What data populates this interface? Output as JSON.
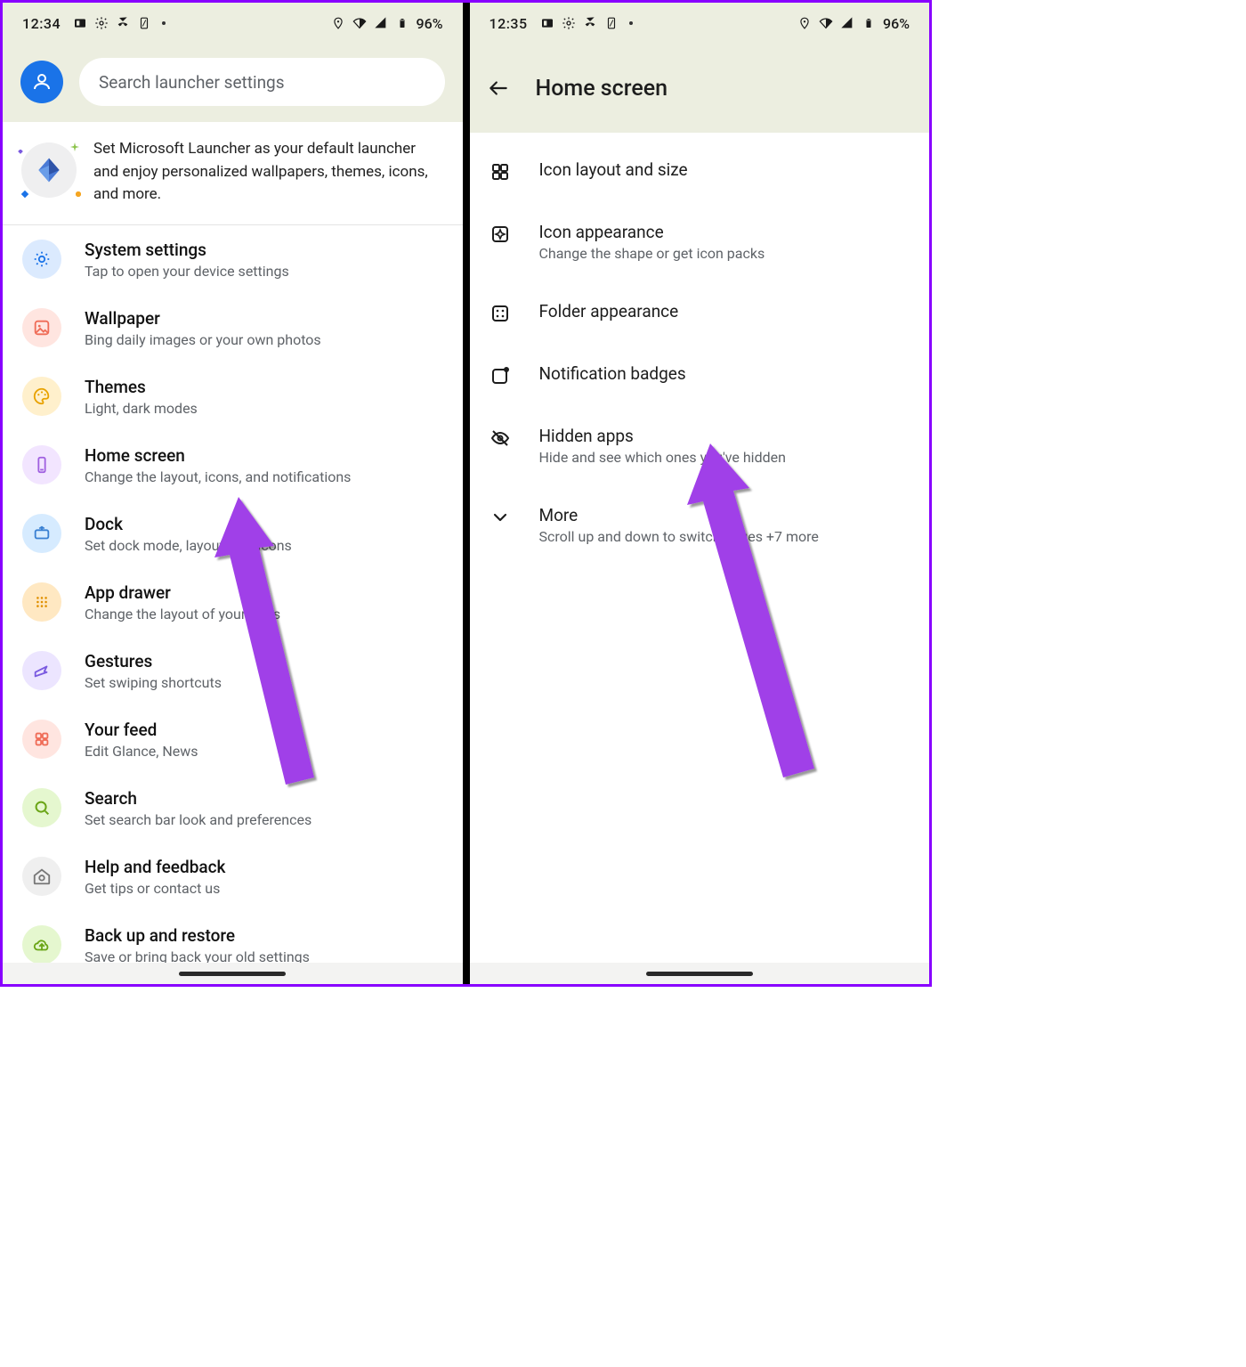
{
  "left": {
    "status": {
      "time": "12:34",
      "battery": "96%"
    },
    "search_placeholder": "Search launcher settings",
    "banner": "Set Microsoft Launcher as your default launcher and enjoy personalized wallpapers, themes, icons, and more.",
    "items": [
      {
        "title": "System settings",
        "sub": "Tap to open your device settings",
        "bg": "#dbeafe",
        "icon": "gear",
        "stroke": "#1a73e8"
      },
      {
        "title": "Wallpaper",
        "sub": "Bing daily images or your own photos",
        "bg": "#ffe5e0",
        "icon": "image",
        "stroke": "#ef6c57"
      },
      {
        "title": "Themes",
        "sub": "Light, dark modes",
        "bg": "#fff0cc",
        "icon": "palette",
        "stroke": "#e8a200"
      },
      {
        "title": "Home screen",
        "sub": "Change the layout, icons, and notifications",
        "bg": "#f2e5ff",
        "icon": "phone",
        "stroke": "#a060e0"
      },
      {
        "title": "Dock",
        "sub": "Set dock mode, layout, and icons",
        "bg": "#d6ebff",
        "icon": "dock",
        "stroke": "#3a80d2"
      },
      {
        "title": "App drawer",
        "sub": "Change the layout of your apps",
        "bg": "#ffe8c2",
        "icon": "grid",
        "stroke": "#e09000"
      },
      {
        "title": "Gestures",
        "sub": "Set swiping shortcuts",
        "bg": "#ece5ff",
        "icon": "swipe",
        "stroke": "#7a5ae0"
      },
      {
        "title": "Your feed",
        "sub": "Edit Glance, News",
        "bg": "#ffe5e0",
        "icon": "feed",
        "stroke": "#ef6c57"
      },
      {
        "title": "Search",
        "sub": "Set search bar look and preferences",
        "bg": "#e5f7cf",
        "icon": "search",
        "stroke": "#6aa516"
      },
      {
        "title": "Help and feedback",
        "sub": "Get tips or contact us",
        "bg": "#efefef",
        "icon": "help",
        "stroke": "#777"
      },
      {
        "title": "Back up and restore",
        "sub": "Save or bring back your old settings",
        "bg": "#e5f7cf",
        "icon": "cloud",
        "stroke": "#6aa516"
      }
    ]
  },
  "right": {
    "status": {
      "time": "12:35",
      "battery": "96%"
    },
    "title": "Home screen",
    "items": [
      {
        "title": "Icon layout and size",
        "sub": "",
        "icon": "layout"
      },
      {
        "title": "Icon appearance",
        "sub": "Change the shape or get icon packs",
        "icon": "sparkle"
      },
      {
        "title": "Folder appearance",
        "sub": "",
        "icon": "folder"
      },
      {
        "title": "Notification badges",
        "sub": "",
        "icon": "badge"
      },
      {
        "title": "Hidden apps",
        "sub": "Hide and see which ones you've hidden",
        "icon": "eyeoff"
      },
      {
        "title": "More",
        "sub": "Scroll up and down to switch pages +7 more",
        "icon": "chevron"
      }
    ]
  }
}
